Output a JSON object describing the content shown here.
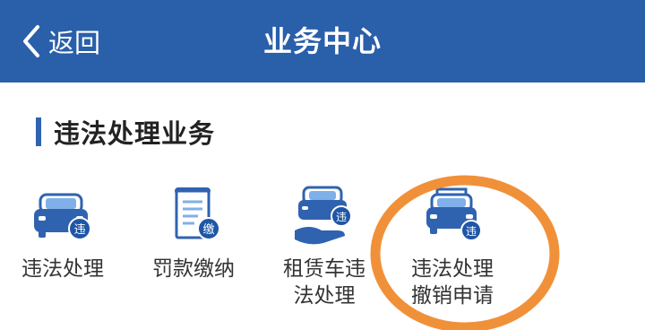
{
  "header": {
    "back_label": "返回",
    "title": "业务中心",
    "background": "#2a5faa"
  },
  "section": {
    "title": "违法处理业务",
    "accent": "#2f63b0"
  },
  "services": [
    {
      "label_line1": "违法处理",
      "label_line2": "",
      "icon": "car-violation-icon",
      "badge": "违"
    },
    {
      "label_line1": "罚款缴纳",
      "label_line2": "",
      "icon": "document-pay-icon",
      "badge": "缴"
    },
    {
      "label_line1": "租赁车违",
      "label_line2": "法处理",
      "icon": "rental-car-violation-icon",
      "badge": "违"
    },
    {
      "label_line1": "违法处理",
      "label_line2": "撤销申请",
      "icon": "cancel-violation-icon",
      "badge": "违"
    }
  ],
  "annotation": {
    "highlight_color": "#f0913a"
  }
}
